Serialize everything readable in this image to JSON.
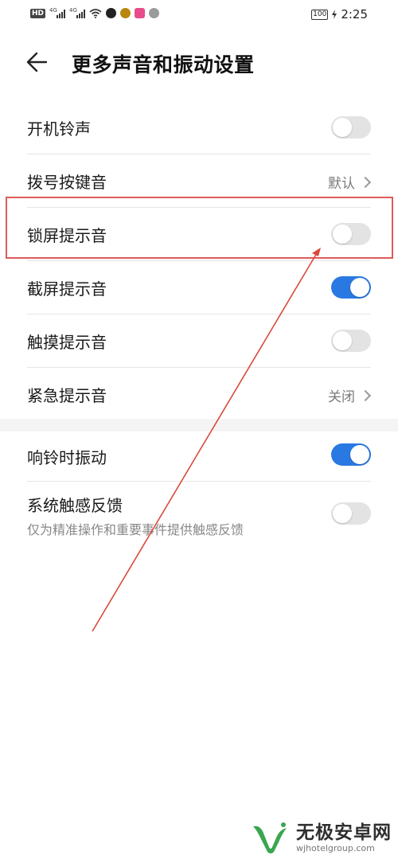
{
  "status_bar": {
    "network_hd": "HD",
    "signal_1": "4G",
    "signal_2": "4G",
    "battery": "100",
    "time": "2:25"
  },
  "header": {
    "title": "更多声音和振动设置"
  },
  "settings": {
    "items": [
      {
        "label": "开机铃声",
        "control": "toggle",
        "on": false
      },
      {
        "label": "拨号按键音",
        "control": "link",
        "value": "默认"
      },
      {
        "label": "锁屏提示音",
        "control": "toggle",
        "on": false
      },
      {
        "label": "截屏提示音",
        "control": "toggle",
        "on": true
      },
      {
        "label": "触摸提示音",
        "control": "toggle",
        "on": false
      },
      {
        "label": "紧急提示音",
        "control": "link",
        "value": "关闭"
      }
    ],
    "items2": [
      {
        "label": "响铃时振动",
        "control": "toggle",
        "on": true
      },
      {
        "label": "系统触感反馈",
        "sublabel": "仅为精准操作和重要事件提供触感反馈",
        "control": "toggle",
        "on": false
      }
    ]
  },
  "colors": {
    "toggle_on": "#2a79e3",
    "toggle_off": "#e3e3e3",
    "annotation_red": "#e05a5a"
  },
  "watermark": {
    "name": "无极安卓网",
    "url": "wjhotelgroup.com"
  }
}
